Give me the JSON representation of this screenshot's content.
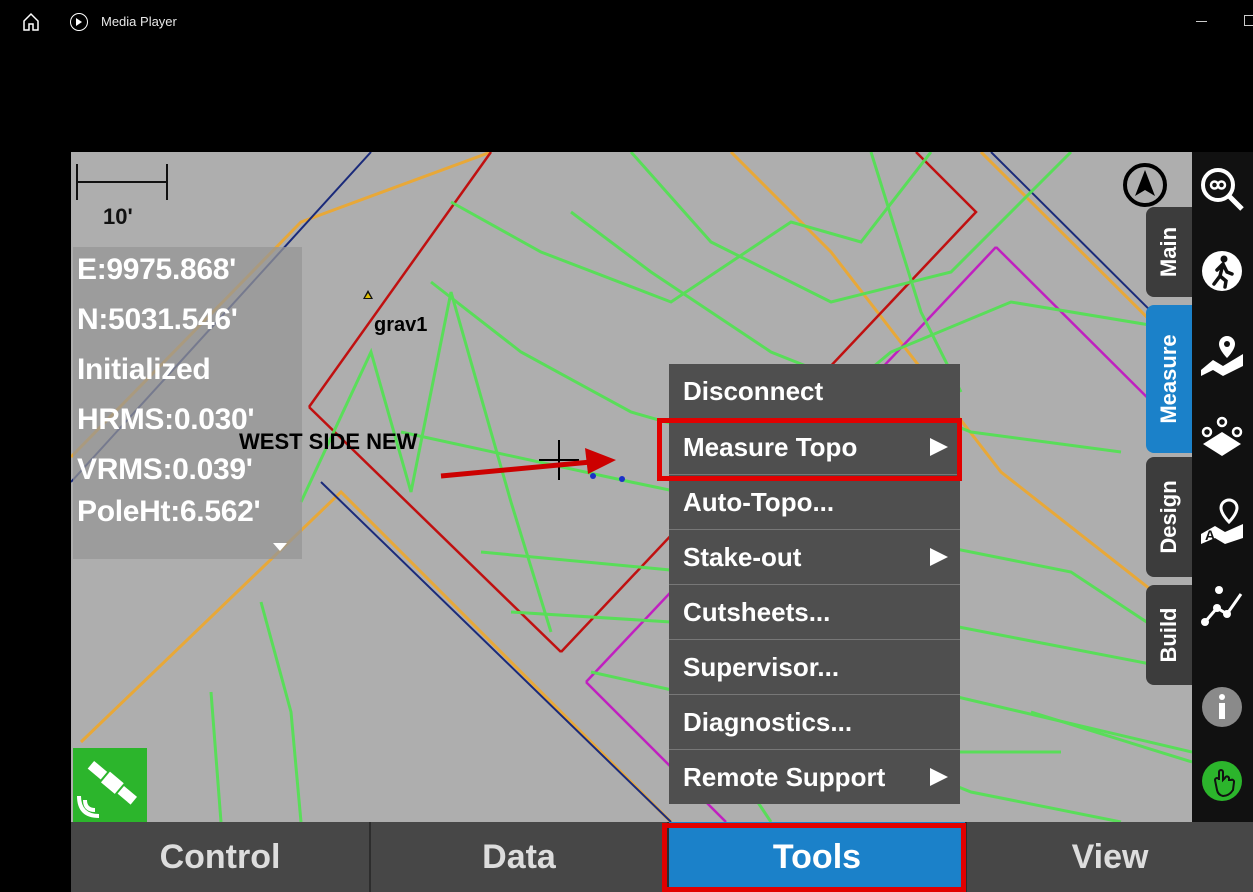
{
  "window": {
    "title": "Media Player"
  },
  "map": {
    "scale_label": "10'",
    "info_lines": [
      "E:9975.868'",
      "N:5031.546'",
      "Initialized",
      "HRMS:0.030'",
      "VRMS:0.039'",
      "PoleHt:6.562'"
    ],
    "point_label": "grav1",
    "area_label": "WEST SIDE NEW"
  },
  "side_tabs": [
    "Main",
    "Measure",
    "Design",
    "Build"
  ],
  "tools_menu": {
    "items": [
      {
        "label": "Disconnect",
        "submenu": false
      },
      {
        "label": "Measure Topo",
        "submenu": true
      },
      {
        "label": "Auto-Topo...",
        "submenu": false
      },
      {
        "label": "Stake-out",
        "submenu": true
      },
      {
        "label": "Cutsheets...",
        "submenu": false
      },
      {
        "label": "Supervisor...",
        "submenu": false
      },
      {
        "label": "Diagnostics...",
        "submenu": false
      },
      {
        "label": "Remote Support",
        "submenu": true
      }
    ]
  },
  "bottom_tabs": [
    "Control",
    "Data",
    "Tools",
    "View"
  ],
  "active_bottom_tab": "Tools",
  "active_side_tab": "Measure",
  "colors": {
    "accent": "#1b81c9",
    "highlight": "#e10000",
    "map_bg": "#aeaeae",
    "gnss": "#2cb52c"
  },
  "right_toolbar_icons": [
    "zoom-search-icon",
    "walking-person-icon",
    "map-pin-icon",
    "points-icon",
    "map-label-pin-icon",
    "route-icon",
    "info-icon",
    "hand-pointer-icon"
  ]
}
